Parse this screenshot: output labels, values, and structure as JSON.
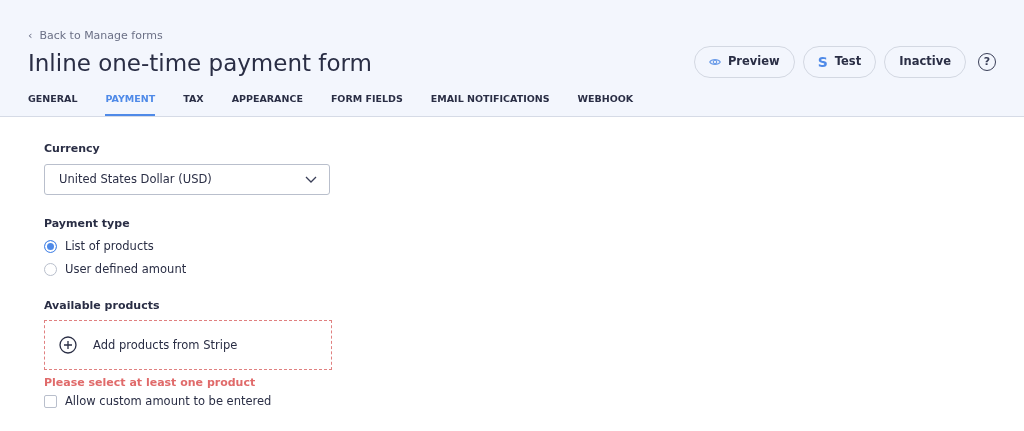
{
  "back_link": {
    "arrow": "‹",
    "label": "Back to Manage forms"
  },
  "title": "Inline one-time payment form",
  "actions": [
    {
      "kind": "eye",
      "label": "Preview"
    },
    {
      "kind": "glyph",
      "glyph": "S",
      "label": "Test"
    },
    {
      "kind": "plain",
      "label": "Inactive"
    }
  ],
  "help_glyph": "?",
  "tabs": [
    {
      "label": "GENERAL",
      "selected": false
    },
    {
      "label": "PAYMENT",
      "selected": true
    },
    {
      "label": "TAX",
      "selected": false
    },
    {
      "label": "APPEARANCE",
      "selected": false
    },
    {
      "label": "FORM FIELDS",
      "selected": false
    },
    {
      "label": "EMAIL NOTIFICATIONS",
      "selected": false
    },
    {
      "label": "WEBHOOK",
      "selected": false
    }
  ],
  "currency": {
    "label": "Currency",
    "value": "United States Dollar (USD)"
  },
  "payment_type": {
    "label": "Payment type",
    "options": [
      {
        "label": "List of products",
        "selected": true
      },
      {
        "label": "User defined amount",
        "selected": false
      }
    ]
  },
  "products": {
    "label": "Available products",
    "add_label": "Add products from Stripe",
    "invalid": true,
    "error": "Please select at least one product"
  },
  "allow_custom": {
    "label": "Allow custom amount to be entered",
    "checked": false
  }
}
